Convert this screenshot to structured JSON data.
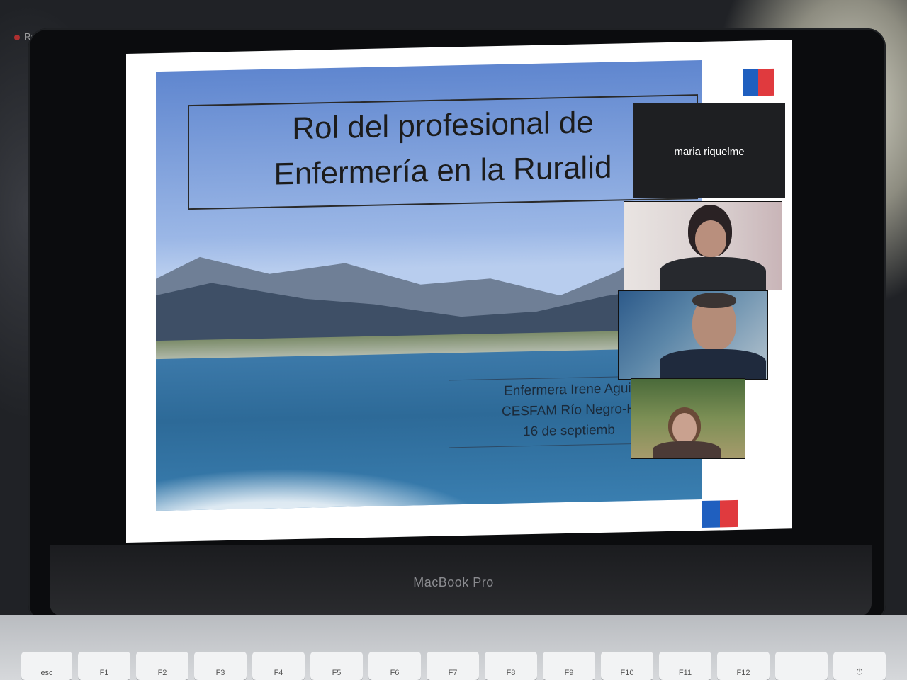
{
  "recording": {
    "label": "Recording"
  },
  "laptop": {
    "brand": "MacBook Pro"
  },
  "slide": {
    "title_line_1": "Rol del profesional de",
    "title_line_2": "Enfermería en la Ruralid",
    "author_line_1": "Enfermera Irene Aguil",
    "author_line_2": "CESFAM Río Negro-H",
    "author_line_3": "16 de septiemb"
  },
  "meeting": {
    "active_speaker": "maria riquelme"
  },
  "keys": [
    "esc",
    "F1",
    "F2",
    "F3",
    "F4",
    "F5",
    "F6",
    "F7",
    "F8",
    "F9",
    "F10",
    "F11",
    "F12"
  ],
  "colors": {
    "flag_blue": "#1f5fbf",
    "flag_red": "#e03a3e"
  }
}
